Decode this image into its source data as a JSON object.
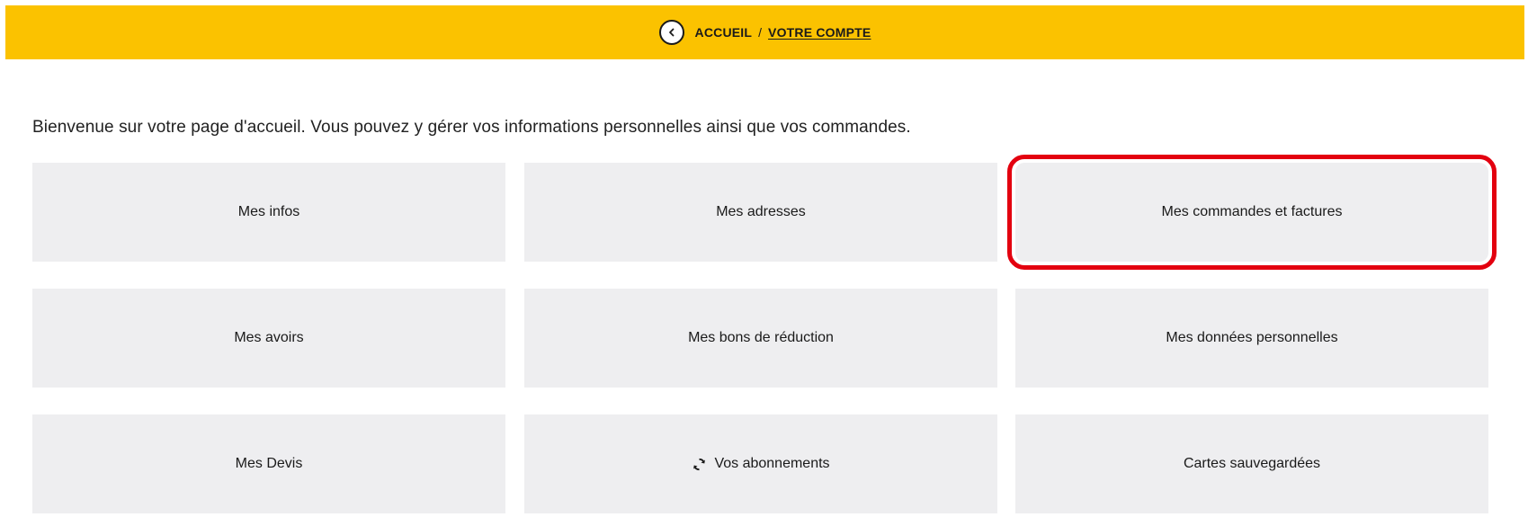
{
  "breadcrumb": {
    "home": "ACCUEIL",
    "separator": "/",
    "current": "VOTRE COMPTE",
    "back_icon": "chevron-left-circle"
  },
  "intro_text": "Bienvenue sur votre page d'accueil. Vous pouvez y gérer vos informations personnelles ainsi que vos commandes.",
  "tiles": [
    {
      "label": "Mes infos"
    },
    {
      "label": "Mes adresses"
    },
    {
      "label": "Mes commandes et factures",
      "highlighted": true
    },
    {
      "label": "Mes avoirs"
    },
    {
      "label": "Mes bons de réduction"
    },
    {
      "label": "Mes données personnelles"
    },
    {
      "label": "Mes Devis"
    },
    {
      "label": "Vos abonnements",
      "icon": "sync-icon"
    },
    {
      "label": "Cartes sauvegardées"
    }
  ],
  "colors": {
    "topbar": "#fbc200",
    "tile_background": "#eeeef0",
    "highlight": "#e3000f"
  }
}
